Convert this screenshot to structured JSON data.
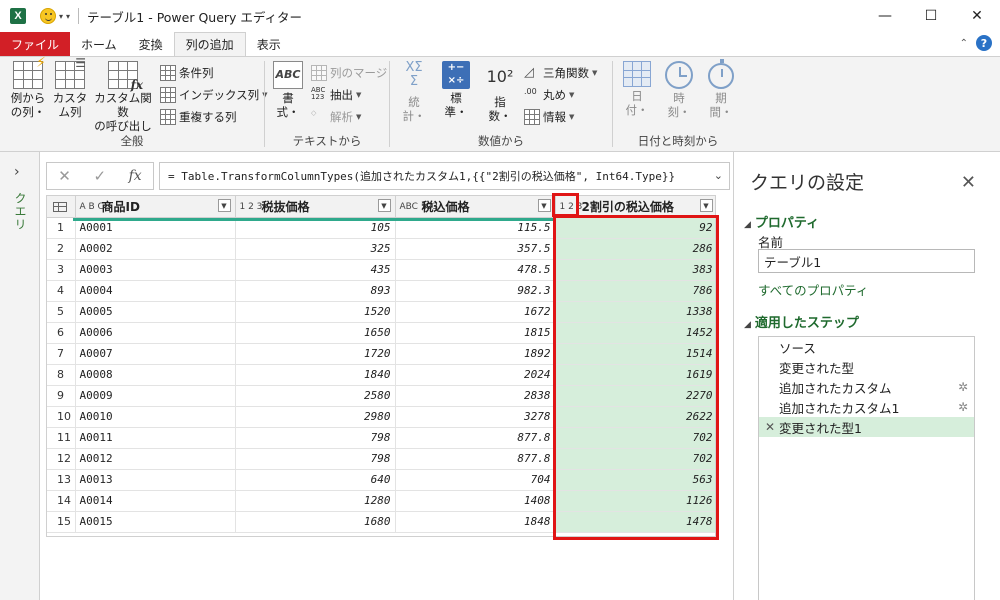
{
  "app": {
    "logo": "X",
    "title": "テーブル1 - Power Query エディター"
  },
  "tabs": [
    {
      "label": "ファイル"
    },
    {
      "label": "ホーム"
    },
    {
      "label": "変換"
    },
    {
      "label": "列の追加"
    },
    {
      "label": "表示"
    }
  ],
  "ribbon": {
    "general": {
      "label": "全般",
      "example_col": [
        "例から",
        "の列・"
      ],
      "custom_col": [
        "カスタ",
        "ム列"
      ],
      "invoke_func": [
        "カスタム関数",
        "の呼び出し"
      ],
      "conditional": "条件列",
      "index": "インデックス列",
      "duplicate": "重複する列"
    },
    "text": {
      "label": "テキストから",
      "format": [
        "書",
        "式・"
      ],
      "merge": "列のマージ",
      "extract": "抽出",
      "parse": "解析",
      "abc_glyph": "ABC",
      "abc123_glyph": [
        "ABC",
        "123"
      ]
    },
    "number": {
      "label": "数値から",
      "stats": [
        "統",
        "計・"
      ],
      "standard": [
        "標",
        "準・"
      ],
      "scientific": [
        "指",
        "数・"
      ],
      "trig": "三角関数",
      "rounding": "丸め",
      "info": "情報",
      "sigma_glyph": [
        "XΣ",
        "Σ"
      ],
      "power_glyph": "10²"
    },
    "datetime": {
      "label": "日付と時刻から",
      "date": [
        "日",
        "付・"
      ],
      "time": [
        "時",
        "刻・"
      ],
      "duration": [
        "期",
        "間・"
      ]
    }
  },
  "formula": "= Table.TransformColumnTypes(追加されたカスタム1,{{\"2割引の税込価格\", Int64.Type}}",
  "left_pane_label": "クエリ",
  "columns": [
    {
      "type": "A B C",
      "name": "商品ID"
    },
    {
      "type": "1 2 3",
      "name": "税抜価格"
    },
    {
      "type": "ABC 123",
      "name": "税込価格"
    },
    {
      "type": "1 2 3",
      "name": "2割引の税込価格"
    }
  ],
  "rows": [
    [
      "1",
      "A0001",
      "105",
      "115.5",
      "92"
    ],
    [
      "2",
      "A0002",
      "325",
      "357.5",
      "286"
    ],
    [
      "3",
      "A0003",
      "435",
      "478.5",
      "383"
    ],
    [
      "4",
      "A0004",
      "893",
      "982.3",
      "786"
    ],
    [
      "5",
      "A0005",
      "1520",
      "1672",
      "1338"
    ],
    [
      "6",
      "A0006",
      "1650",
      "1815",
      "1452"
    ],
    [
      "7",
      "A0007",
      "1720",
      "1892",
      "1514"
    ],
    [
      "8",
      "A0008",
      "1840",
      "2024",
      "1619"
    ],
    [
      "9",
      "A0009",
      "2580",
      "2838",
      "2270"
    ],
    [
      "10",
      "A0010",
      "2980",
      "3278",
      "2622"
    ],
    [
      "11",
      "A0011",
      "798",
      "877.8",
      "702"
    ],
    [
      "12",
      "A0012",
      "798",
      "877.8",
      "702"
    ],
    [
      "13",
      "A0013",
      "640",
      "704",
      "563"
    ],
    [
      "14",
      "A0014",
      "1280",
      "1408",
      "1126"
    ],
    [
      "15",
      "A0015",
      "1680",
      "1848",
      "1478"
    ]
  ],
  "settings": {
    "title": "クエリの設定",
    "properties_head": "プロパティ",
    "name_label": "名前",
    "name_value": "テーブル1",
    "all_properties": "すべてのプロパティ",
    "steps_head": "適用したステップ",
    "steps": [
      {
        "label": "ソース",
        "gear": false,
        "active": false
      },
      {
        "label": "変更された型",
        "gear": false,
        "active": false
      },
      {
        "label": "追加されたカスタム",
        "gear": true,
        "active": false
      },
      {
        "label": "追加されたカスタム1",
        "gear": true,
        "active": false
      },
      {
        "label": "変更された型1",
        "gear": false,
        "active": true
      }
    ]
  },
  "colors": {
    "file_tab": "#d21f26",
    "highlight": "#d6eedb",
    "annotation": "#e01515",
    "accent_green": "#1f6a2e"
  }
}
